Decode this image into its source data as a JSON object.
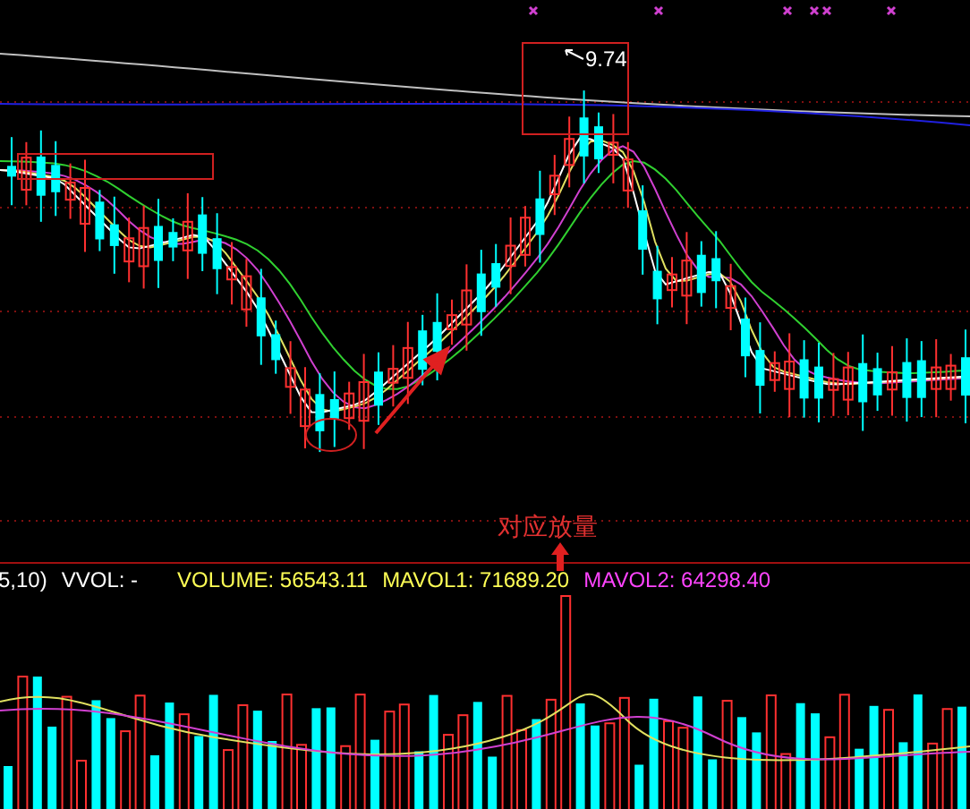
{
  "price_chart": {
    "high_label": "9.74",
    "annotation": "对应放量"
  },
  "volume_legend": [
    {
      "text": "5,10)",
      "color": "#ffffff"
    },
    {
      "text": "VVOL: -",
      "color": "#ffffff"
    },
    {
      "text": "VOLUME: 56543.11",
      "color": "#ffff55"
    },
    {
      "text": "MAVOL1: 71689.20",
      "color": "#ffff55"
    },
    {
      "text": "MAVOL2: 64298.40",
      "color": "#ff44ff"
    }
  ]
}
